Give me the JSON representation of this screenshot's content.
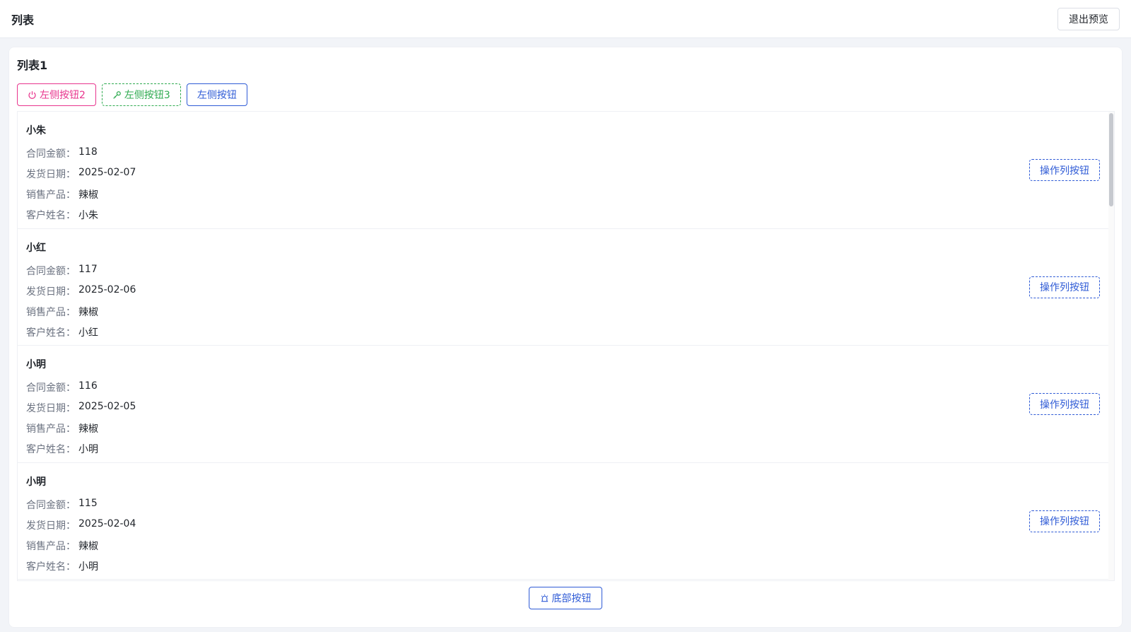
{
  "header": {
    "title": "列表",
    "exit_label": "退出预览"
  },
  "panel": {
    "title": "列表1",
    "left_buttons": {
      "btn2": "左侧按钮2",
      "btn3": "左侧按钮3",
      "btn1": "左侧按钮"
    },
    "field_labels": {
      "amount": "合同金额：",
      "date": "发货日期：",
      "product": "销售产品：",
      "customer": "客户姓名："
    },
    "op_label": "操作列按钮",
    "items": [
      {
        "name": "小朱",
        "amount": "118",
        "date": "2025-02-07",
        "product": "辣椒",
        "customer": "小朱"
      },
      {
        "name": "小红",
        "amount": "117",
        "date": "2025-02-06",
        "product": "辣椒",
        "customer": "小红"
      },
      {
        "name": "小明",
        "amount": "116",
        "date": "2025-02-05",
        "product": "辣椒",
        "customer": "小明"
      },
      {
        "name": "小明",
        "amount": "115",
        "date": "2025-02-04",
        "product": "辣椒",
        "customer": "小明"
      }
    ],
    "bottom_label": "底部按钮"
  },
  "colors": {
    "pink": "#e8348d",
    "green": "#2eaa4f",
    "blue": "#2f5bd6"
  },
  "icons": {
    "btn2": "power-icon",
    "btn3": "wrench-icon",
    "bottom": "alarm-icon"
  }
}
